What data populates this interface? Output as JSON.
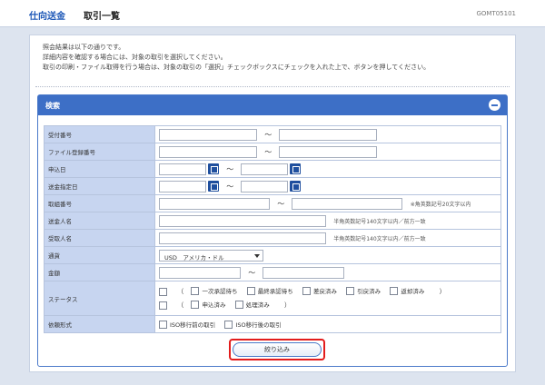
{
  "header": {
    "section": "仕向送金",
    "title": "取引一覧",
    "screen_code": "GOMT05101"
  },
  "intro": {
    "line1": "照会結果は以下の通りです。",
    "line2": "詳細内容を確認する場合には、対象の取引を選択してください。",
    "line3": "取引の印刷・ファイル取得を行う場合は、対象の取引の「選択」チェックボックスにチェックを入れた上で、ボタンを押してください。"
  },
  "search": {
    "title": "検索",
    "rows": {
      "receipt_no": "受付番号",
      "file_reg_no": "ファイル登録番号",
      "apply_date": "申込日",
      "send_date": "送金指定日",
      "trade_no": "取組番号",
      "remitter": "送金人名",
      "beneficiary": "受取人名",
      "currency": "通貨",
      "amount": "金額",
      "status": "ステータス",
      "request_type": "依頼形式"
    },
    "tilde": "～",
    "notes": {
      "trade_no": "※角英数記号20文字以内",
      "remitter": "半角英数記号140文字以内／前方一致",
      "beneficiary": "半角英数記号140文字以内／前方一致"
    },
    "currency_value": "USD　アメリカ・ドル",
    "status_options": {
      "pending_first": "一次承認待ち",
      "pending_final": "最終承認待ち",
      "returned": "差戻済み",
      "withdrawn": "引戻済み",
      "rejected": "返却済み",
      "applied": "申込済み",
      "processed": "処理済み"
    },
    "paren_open": "（",
    "paren_close": "）",
    "request_options": {
      "before": "ISO移行前の取引",
      "after": "ISO移行後の取引"
    },
    "submit_label": "絞り込み"
  }
}
